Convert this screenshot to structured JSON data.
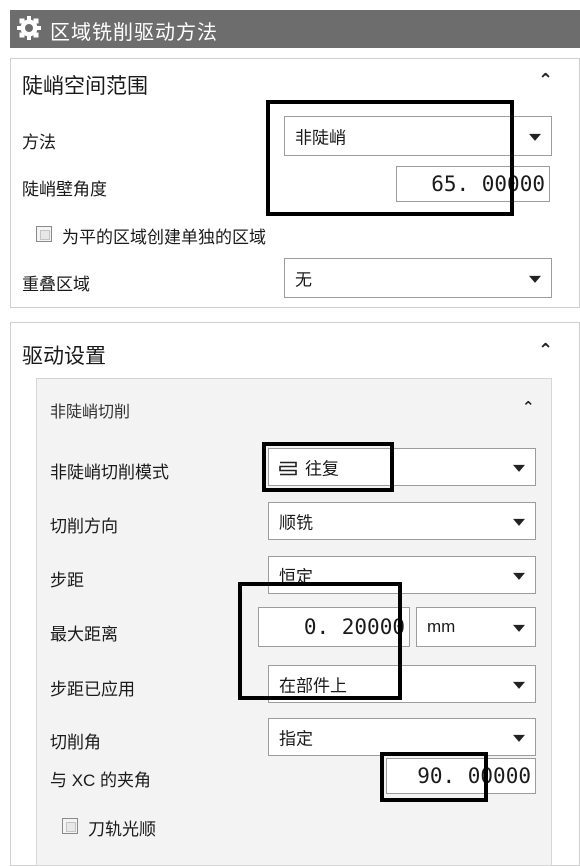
{
  "title": {
    "text": "区域铣削驱动方法",
    "icon": "gear-icon"
  },
  "steep": {
    "header": "陡峭空间范围",
    "method_label": "方法",
    "method_value": "非陡峭",
    "wall_angle_label": "陡峭壁角度",
    "wall_angle_value": "65. 00000",
    "create_region_label": "为平的区域创建单独的区域",
    "overlap_label": "重叠区域",
    "overlap_value": "无"
  },
  "drive": {
    "header": "驱动设置",
    "sub_header": "非陡峭切削",
    "mode_label": "非陡峭切削模式",
    "mode_value": "往复",
    "mode_icon": "zigzag-icon",
    "direction_label": "切削方向",
    "direction_value": "顺铣",
    "stepover_label": "步距",
    "stepover_value": "恒定",
    "max_dist_label": "最大距离",
    "max_dist_value": "0. 20000",
    "max_dist_unit": "mm",
    "applied_label": "步距已应用",
    "applied_value": "在部件上",
    "cut_angle_label": "切削角",
    "cut_angle_value": "指定",
    "xc_angle_label": "与 XC 的夹角",
    "xc_angle_value": "90. 00000",
    "smooth_label": "刀轨光顺"
  },
  "colors": {
    "title_bg": "#6d6d6d",
    "highlight_box": "#000000",
    "inner_bg": "#f3f3f3"
  }
}
